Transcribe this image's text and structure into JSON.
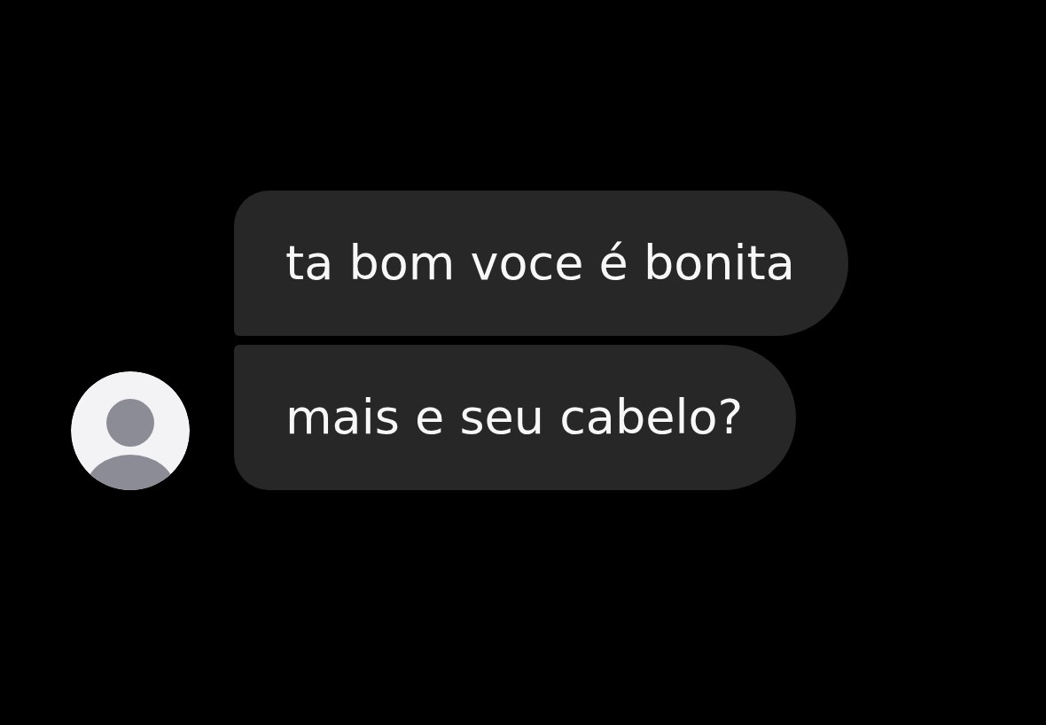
{
  "messages": [
    {
      "text": "ta bom voce é bonita"
    },
    {
      "text": "mais e seu cabelo?"
    }
  ]
}
